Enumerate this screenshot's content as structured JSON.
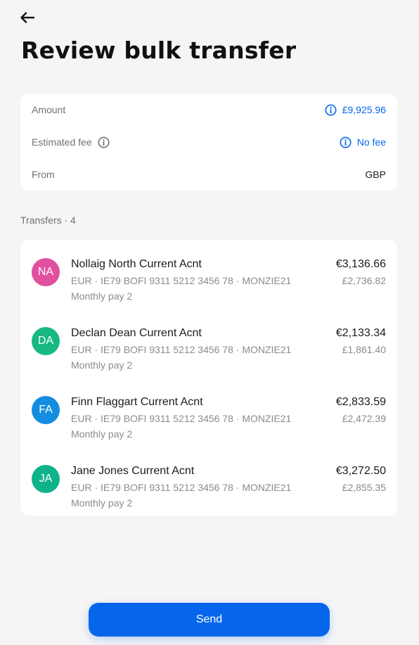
{
  "header": {
    "back_icon": "arrow-left-icon",
    "title": "Review bulk transfer"
  },
  "summary": {
    "amount_label": "Amount",
    "amount_value": "£9,925.96",
    "fee_label": "Estimated fee",
    "fee_value": "No fee",
    "from_label": "From",
    "from_value": "GBP"
  },
  "transfers": {
    "label": "Transfers · 4",
    "items": [
      {
        "initials": "NA",
        "avatar_color": "#e0509f",
        "name": "Nollaig North Current Acnt",
        "details": "EUR · IE79 BOFI 9311 5212 3456 78 · MONZIE21",
        "reference": "Monthly pay 2",
        "amount": "€3,136.66",
        "converted": "£2,736.82"
      },
      {
        "initials": "DA",
        "avatar_color": "#17b881",
        "name": "Declan Dean Current Acnt",
        "details": "EUR · IE79 BOFI 9311 5212 3456 78 · MONZIE21",
        "reference": "Monthly pay 2",
        "amount": "€2,133.34",
        "converted": "£1,861.40"
      },
      {
        "initials": "FA",
        "avatar_color": "#148de0",
        "name": "Finn Flaggart Current Acnt",
        "details": "EUR · IE79 BOFI 9311 5212 3456 78 · MONZIE21",
        "reference": "Monthly pay 2",
        "amount": "€2,833.59",
        "converted": "£2,472.39"
      },
      {
        "initials": "JA",
        "avatar_color": "#0fb38a",
        "name": "Jane Jones Current Acnt",
        "details": "EUR · IE79 BOFI 9311 5212 3456 78 · MONZIE21",
        "reference": "Monthly pay 2",
        "amount": "€3,272.50",
        "converted": "£2,855.35"
      }
    ]
  },
  "actions": {
    "send_label": "Send"
  },
  "colors": {
    "accent": "#0666eb",
    "background": "#f5f5f6",
    "card": "#ffffff"
  }
}
